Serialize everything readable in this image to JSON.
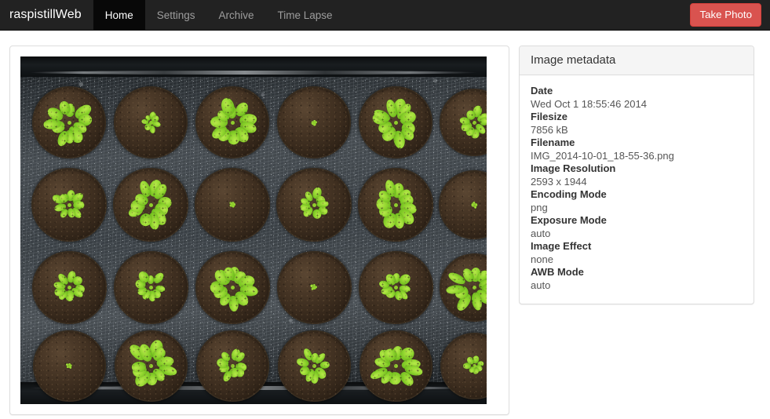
{
  "navbar": {
    "brand": "raspistillWeb",
    "items": [
      {
        "label": "Home",
        "active": true
      },
      {
        "label": "Settings",
        "active": false
      },
      {
        "label": "Archive",
        "active": false
      },
      {
        "label": "Time Lapse",
        "active": false
      }
    ],
    "take_photo_label": "Take Photo",
    "take_photo_color": "#d9534f",
    "background_color": "#222222"
  },
  "photo_panel": {
    "image_alt": "Latest captured photo: tray of 24 Arabidopsis seedlings in round soil pots",
    "grid": {
      "rows": 4,
      "cols": 6,
      "plant_sizes": [
        [
          "large",
          "small",
          "large",
          "tiny",
          "large",
          "medium"
        ],
        [
          "medium",
          "large",
          "tiny",
          "medium",
          "large",
          "tiny"
        ],
        [
          "medium",
          "medium",
          "large",
          "tiny",
          "medium",
          "large"
        ],
        [
          "tiny",
          "large",
          "medium",
          "medium",
          "large",
          "small"
        ]
      ]
    }
  },
  "metadata_panel": {
    "title": "Image metadata",
    "fields": [
      {
        "key": "Date",
        "value": "Wed Oct 1 18:55:46 2014"
      },
      {
        "key": "Filesize",
        "value": "7856 kB"
      },
      {
        "key": "Filename",
        "value": "IMG_2014-10-01_18-55-36.png"
      },
      {
        "key": "Image Resolution",
        "value": "2593 x 1944"
      },
      {
        "key": "Encoding Mode",
        "value": "png"
      },
      {
        "key": "Exposure Mode",
        "value": "auto"
      },
      {
        "key": "Image Effect",
        "value": "none"
      },
      {
        "key": "AWB Mode",
        "value": "auto"
      }
    ]
  }
}
